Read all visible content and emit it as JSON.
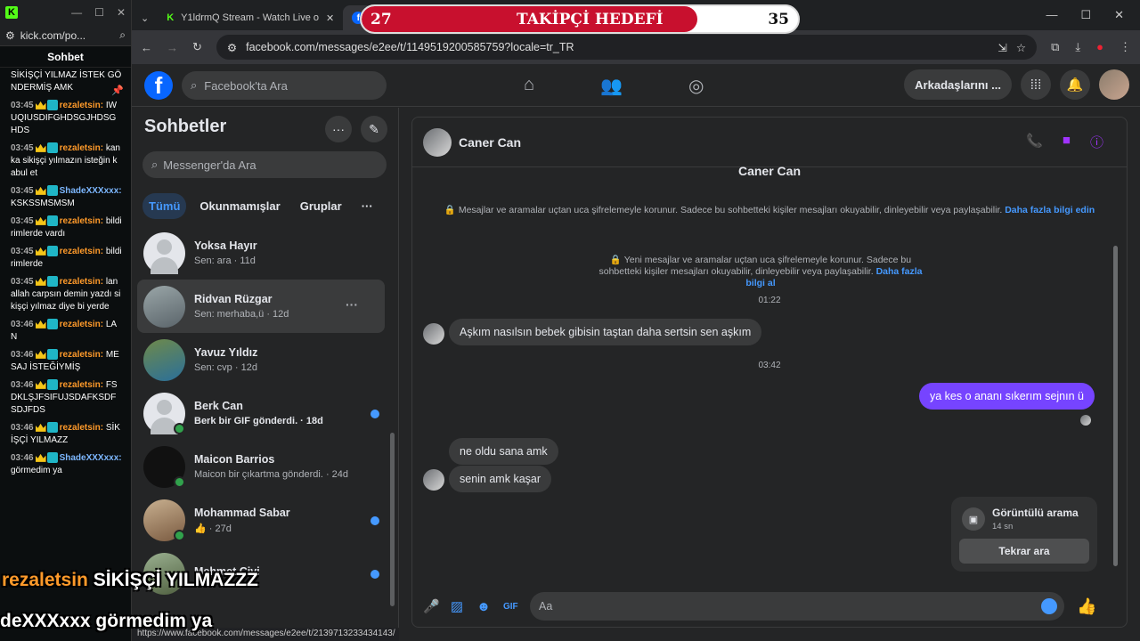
{
  "kick": {
    "url": "kick.com/po...",
    "title": "Sohbet",
    "messages": [
      {
        "time": "",
        "user": "",
        "text": "SİKİŞÇİ YILMAZ İSTEK GÖNDERMİŞ AMK"
      },
      {
        "time": "03:45",
        "user": "rezaletsin:",
        "text": "IWUQIUSDIFGHDSGJHDSGHDS"
      },
      {
        "time": "03:45",
        "user": "rezaletsin:",
        "text": "kanka sikişçi yılmazın isteğin kabul et"
      },
      {
        "time": "03:45",
        "user": "ShadeXXXxxx:",
        "text": "KSKSSMSMSM"
      },
      {
        "time": "03:45",
        "user": "rezaletsin:",
        "text": "bildirimlerde vardı"
      },
      {
        "time": "03:45",
        "user": "rezaletsin:",
        "text": "bildirimlerde"
      },
      {
        "time": "03:45",
        "user": "rezaletsin:",
        "text": "lan allah carpsın demin yazdı sikişçi yılmaz diye bi yerde"
      },
      {
        "time": "03:46",
        "user": "rezaletsin:",
        "text": "LAN"
      },
      {
        "time": "03:46",
        "user": "rezaletsin:",
        "text": "MESAJ İSTEĞİYMİŞ"
      },
      {
        "time": "03:46",
        "user": "rezaletsin:",
        "text": "FSDKLŞJFSIFUJSDAFKSDFSDJFDS"
      },
      {
        "time": "03:46",
        "user": "rezaletsin:",
        "text": "SİKİŞÇİ YILMAZZ"
      },
      {
        "time": "03:46",
        "user": "ShadeXXXxxx:",
        "text": "görmedim ya"
      }
    ]
  },
  "browser": {
    "tab1": "Y1ldrmQ Stream - Watch Live o",
    "url": "facebook.com/messages/e2ee/t/1149519200585759?locale=tr_TR",
    "status_url": "https://www.facebook.com/messages/e2ee/t/2139713233434143/"
  },
  "goal": {
    "current": "27",
    "label": "TAKİPÇİ HEDEFİ",
    "target": "35",
    "progress": 0.77
  },
  "fb": {
    "search_placeholder": "Facebook'ta Ara",
    "friends_button": "Arkadaşlarını ..."
  },
  "sidebar": {
    "title": "Sohbetler",
    "search_placeholder": "Messenger'da Ara",
    "filters": [
      "Tümü",
      "Okunmamışlar",
      "Gruplar"
    ],
    "conversations": [
      {
        "name": "Yoksa Hayır",
        "sub": "Sen: ara · 11d"
      },
      {
        "name": "Ridvan Rüzgar",
        "sub": "Sen: merhaba,ü · 12d"
      },
      {
        "name": "Yavuz Yıldız",
        "sub": "Sen: cvp · 12d"
      },
      {
        "name": "Berk Can",
        "sub": "Berk bir GIF gönderdi. · 18d"
      },
      {
        "name": "Maicon Barrios",
        "sub": "Maicon bir çıkartma gönderdi. · 24d"
      },
      {
        "name": "Mohammad Sabar",
        "sub": "👍 · 27d"
      },
      {
        "name": "Mehmet Çivi",
        "sub": ""
      }
    ]
  },
  "chat": {
    "contact": "Caner Can",
    "title": "Caner Can",
    "enc1": "Mesajlar ve aramalar uçtan uca şifrelemeyle korunur. Sadece bu sohbetteki kişiler mesajları okuyabilir, dinleyebilir veya paylaşabilir.",
    "enc1_link": "Daha fazla bilgi edin",
    "enc2": "Yeni mesajlar ve aramalar uçtan uca şifrelemeyle korunur. Sadece bu sohbetteki kişiler mesajları okuyabilir, dinleyebilir veya paylaşabilir.",
    "enc2_link": "Daha fazla bilgi al",
    "ts1": "01:22",
    "msg1": "Aşkım nasılsın bebek gibisin taştan daha sertsin sen aşkım",
    "ts2": "03:42",
    "msg_me": "ya kes o ananı sıkerım sejnın ü",
    "msg2": "ne oldu sana amk",
    "msg3": "senin amk kaşar",
    "call_title": "Görüntülü arama",
    "call_dur": "14 sn",
    "call_btn": "Tekrar ara",
    "composer_placeholder": "Aa"
  },
  "overlay": {
    "line1_user": "rezaletsin",
    "line1_text": "SİKİŞÇİ YILMAZZZ",
    "line2_user": "deXXXxxx",
    "line2_text": "görmedim ya"
  }
}
